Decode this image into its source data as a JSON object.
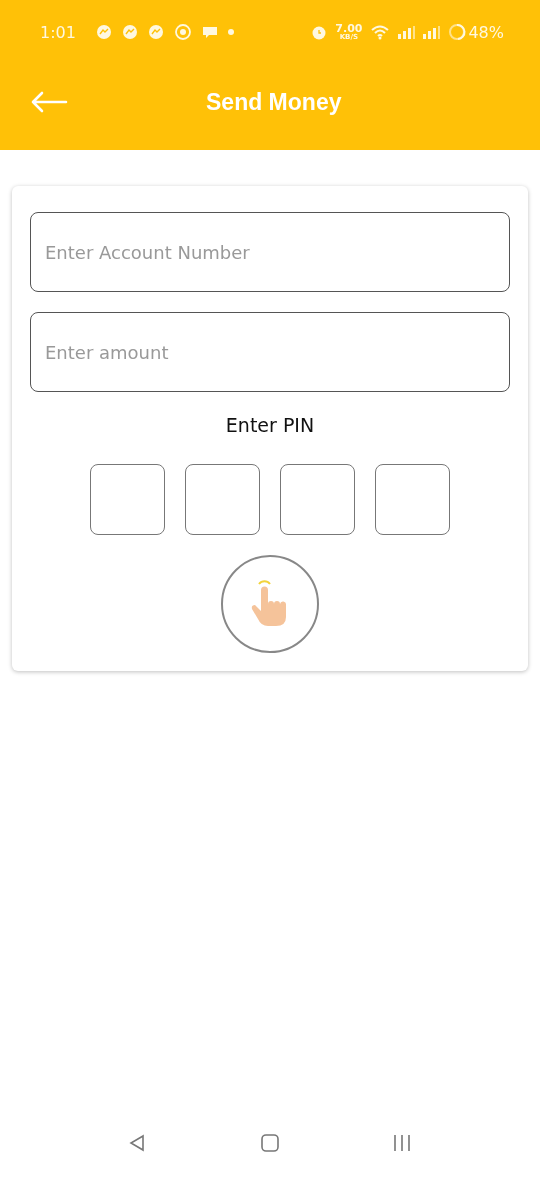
{
  "status_bar": {
    "time": "1:01",
    "speed": "7.00",
    "speed_unit": "KB/S",
    "battery": "48%"
  },
  "header": {
    "title": "Send Money"
  },
  "form": {
    "fields": [
      {
        "placeholder": "Enter Account Number"
      },
      {
        "placeholder": "Enter amount"
      }
    ],
    "pin_label": "Enter PIN"
  }
}
